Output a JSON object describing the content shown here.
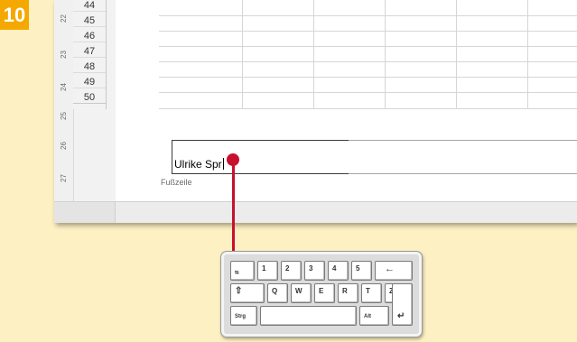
{
  "step": {
    "number": "10",
    "color": "#f5a800"
  },
  "ruler": {
    "numbers": [
      "22",
      "23",
      "24",
      "25",
      "26",
      "27"
    ]
  },
  "rows": [
    "44",
    "45",
    "46",
    "47",
    "48",
    "49",
    "50"
  ],
  "footer": {
    "typed_text": "Ulrike Spr",
    "label": "Fußzeile"
  },
  "pointer": {
    "color": "#c8102e"
  },
  "keyboard": {
    "row1": [
      "⭾",
      "1",
      "2",
      "3",
      "4",
      "5",
      "←"
    ],
    "row2": [
      "⇧",
      "Q",
      "W",
      "E",
      "R",
      "T",
      "Z"
    ],
    "row3": [
      "Strg",
      "",
      "Alt",
      "↵"
    ]
  }
}
